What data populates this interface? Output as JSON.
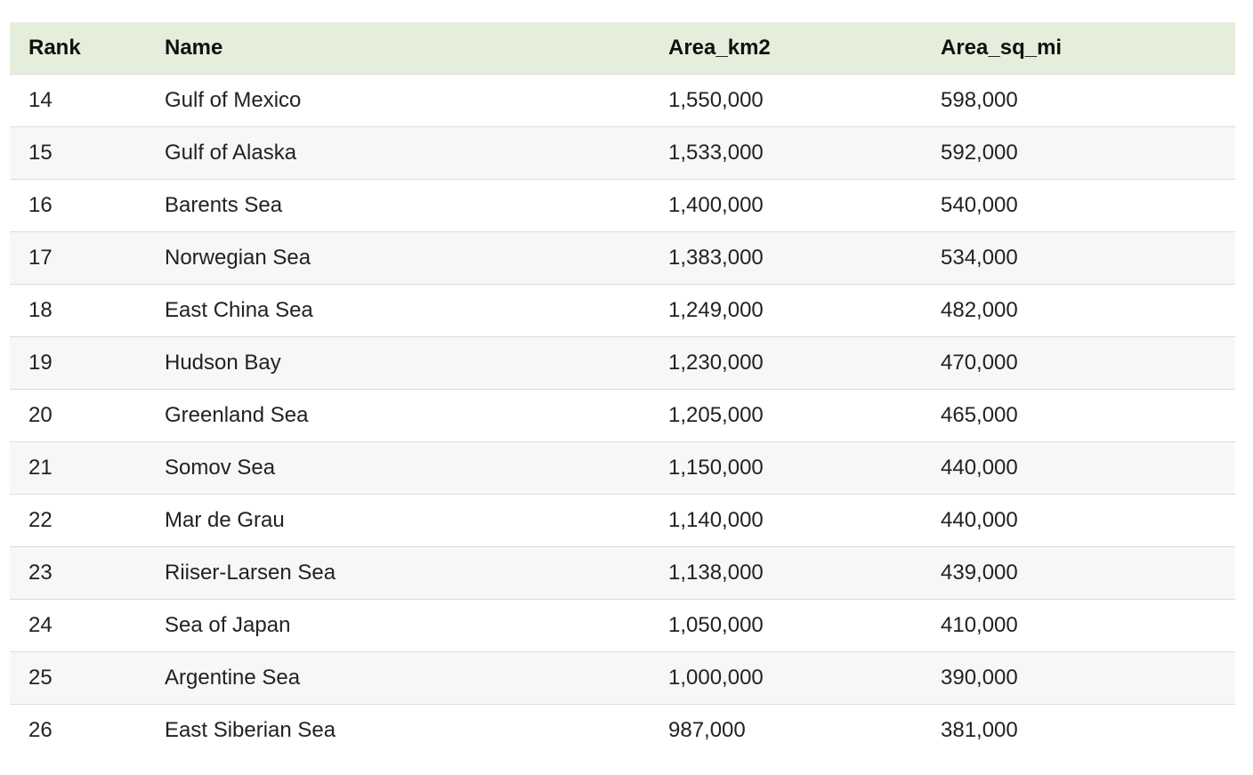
{
  "table": {
    "headers": [
      "Rank",
      "Name",
      "Area_km2",
      "Area_sq_mi"
    ],
    "rows": [
      [
        "14",
        "Gulf of Mexico",
        "1,550,000",
        "598,000"
      ],
      [
        "15",
        "Gulf of Alaska",
        "1,533,000",
        "592,000"
      ],
      [
        "16",
        "Barents Sea",
        "1,400,000",
        "540,000"
      ],
      [
        "17",
        "Norwegian Sea",
        "1,383,000",
        "534,000"
      ],
      [
        "18",
        "East China Sea",
        "1,249,000",
        "482,000"
      ],
      [
        "19",
        "Hudson Bay",
        "1,230,000",
        "470,000"
      ],
      [
        "20",
        "Greenland Sea",
        "1,205,000",
        "465,000"
      ],
      [
        "21",
        "Somov Sea",
        "1,150,000",
        "440,000"
      ],
      [
        "22",
        "Mar de Grau",
        "1,140,000",
        "440,000"
      ],
      [
        "23",
        "Riiser-Larsen Sea",
        "1,138,000",
        "439,000"
      ],
      [
        "24",
        "Sea of Japan",
        "1,050,000",
        "410,000"
      ],
      [
        "25",
        "Argentine Sea",
        "1,000,000",
        "390,000"
      ],
      [
        "26",
        "East Siberian Sea",
        "987,000",
        "381,000"
      ]
    ]
  },
  "colors": {
    "header_background": "#e5eedb",
    "stripe_background": "#f7f7f7",
    "row_border": "#dcdcdc"
  }
}
